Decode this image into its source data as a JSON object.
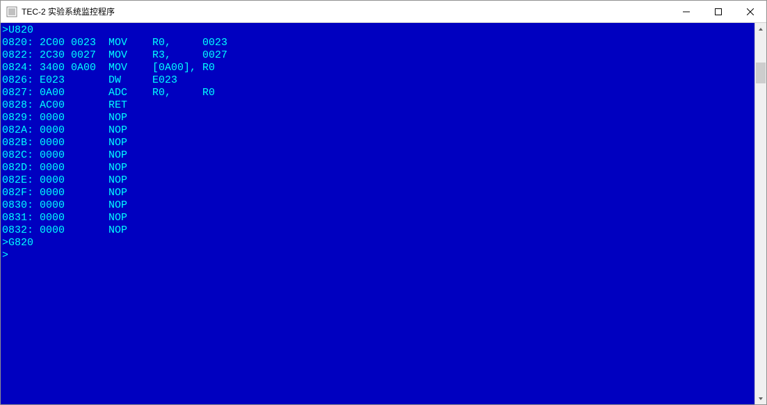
{
  "window": {
    "title": "TEC-2 实验系统监控程序"
  },
  "terminal": {
    "lines": [
      ">U820",
      "0820: 2C00 0023  MOV    R0,     0023",
      "0822: 2C30 0027  MOV    R3,     0027",
      "0824: 3400 0A00  MOV    [0A00], R0",
      "0826: E023       DW     E023",
      "0827: 0A00       ADC    R0,     R0",
      "0828: AC00       RET",
      "0829: 0000       NOP",
      "082A: 0000       NOP",
      "082B: 0000       NOP",
      "082C: 0000       NOP",
      "082D: 0000       NOP",
      "082E: 0000       NOP",
      "082F: 0000       NOP",
      "0830: 0000       NOP",
      "0831: 0000       NOP",
      "0832: 0000       NOP",
      ">G820",
      ">"
    ]
  },
  "colors": {
    "terminal_bg": "#0000c0",
    "terminal_fg": "#00ffff"
  }
}
